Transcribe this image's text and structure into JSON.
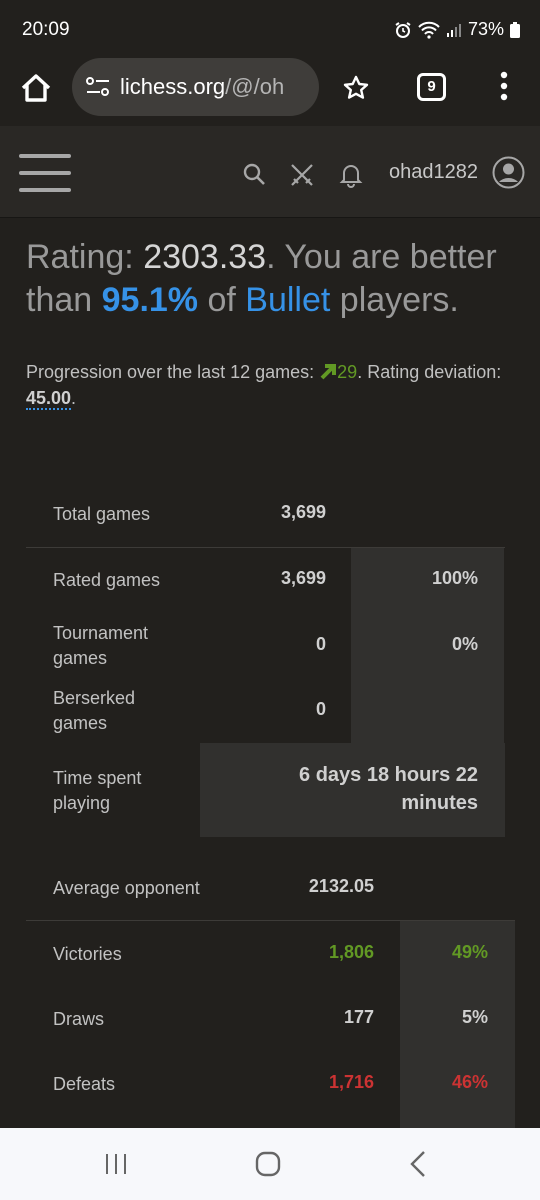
{
  "status": {
    "time": "20:09",
    "battery": "73%"
  },
  "browser": {
    "url_host": "lichess.org",
    "url_path": "/@/oh",
    "tab_count": "9"
  },
  "site": {
    "username": "ohad1282"
  },
  "rating": {
    "prefix": "Rating: ",
    "value": "2303.33",
    "mid": ". You are better than ",
    "percentile": "95.1%",
    "of": " of ",
    "variant": "Bullet",
    "suffix": " players."
  },
  "progression": {
    "text": "Progression over the last 12 games: ",
    "delta": "29",
    "mid": ". Rating deviation: ",
    "deviation": "45.00",
    "end": "."
  },
  "stats": {
    "total_label": "Total games",
    "total_value": "3,699",
    "rated_label": "Rated games",
    "rated_value": "3,699",
    "rated_pct": "100%",
    "tournament_label": "Tournament games",
    "tournament_value": "0",
    "tournament_pct": "0%",
    "berserked_label": "Berserked games",
    "berserked_value": "0",
    "time_label": "Time spent playing",
    "time_value": "6 days 18 hours 22 minutes",
    "avg_label": "Average opponent",
    "avg_value": "2132.05",
    "victories_label": "Victories",
    "victories_value": "1,806",
    "victories_pct": "49%",
    "draws_label": "Draws",
    "draws_value": "177",
    "draws_pct": "5%",
    "defeats_label": "Defeats",
    "defeats_value": "1,716",
    "defeats_pct": "46%"
  },
  "colors": {
    "accent_blue": "#3692e7",
    "win_green": "#629924",
    "loss_red": "#cc3333",
    "background": "#22201d"
  }
}
